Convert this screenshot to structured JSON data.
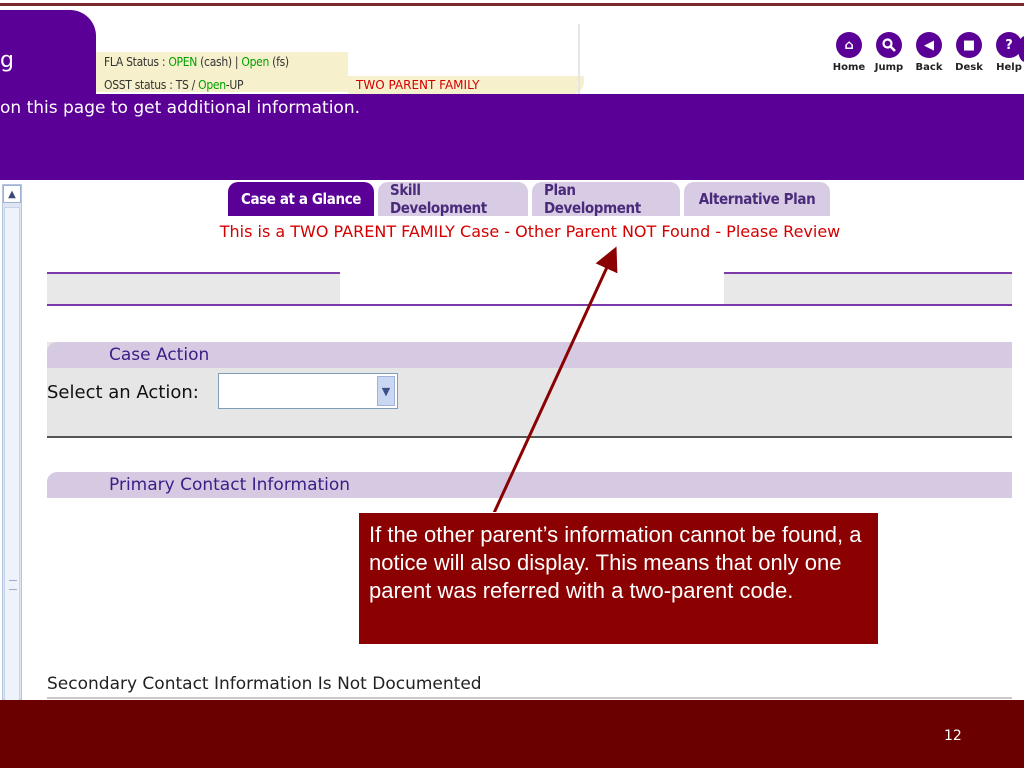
{
  "header": {
    "app_tab_fragment": "g",
    "fla_status": {
      "prefix": "FLA Status : ",
      "cash_value": "OPEN",
      "cash_suffix": " (cash) | ",
      "fs_value": "Open",
      "fs_suffix": " (fs)"
    },
    "osst_status": {
      "prefix": "OSST status : TS / ",
      "value": "Open",
      "suffix": "-UP"
    },
    "family_type": "TWO PARENT FAMILY",
    "nav": [
      {
        "label": "Home",
        "icon": "home-icon",
        "glyph": "⌂"
      },
      {
        "label": "Jump",
        "icon": "search-icon",
        "glyph": "🔍"
      },
      {
        "label": "Back",
        "icon": "back-icon",
        "glyph": "◀"
      },
      {
        "label": "Desk",
        "icon": "desk-icon",
        "glyph": "■"
      },
      {
        "label": "Help",
        "icon": "help-icon",
        "glyph": "?"
      }
    ]
  },
  "info_band": {
    "text": "on this page to get additional information."
  },
  "tabs": [
    {
      "label": "Case at a Glance",
      "active": true
    },
    {
      "label": "Skill Development",
      "active": false
    },
    {
      "label": "Plan Development",
      "active": false
    },
    {
      "label": "Alternative Plan",
      "active": false
    }
  ],
  "notice": "This is a TWO PARENT FAMILY Case - Other Parent NOT Found - Please Review",
  "case_action": {
    "title": "Case Action",
    "select_label": "Select an Action:",
    "select_value": ""
  },
  "primary_contact": {
    "title": "Primary Contact Information"
  },
  "secondary_contact": {
    "text": "Secondary Contact Information Is Not Documented"
  },
  "callout": {
    "text": "If the other parent’s information cannot be found, a notice will also display.  This means that only one parent was referred with a two-parent code."
  },
  "footer": {
    "page_number": "12"
  },
  "colors": {
    "brand_purple": "#5b0096",
    "alert_red": "#d40000",
    "callout_bg": "#8b0000",
    "footer_bg": "#6b0000"
  }
}
